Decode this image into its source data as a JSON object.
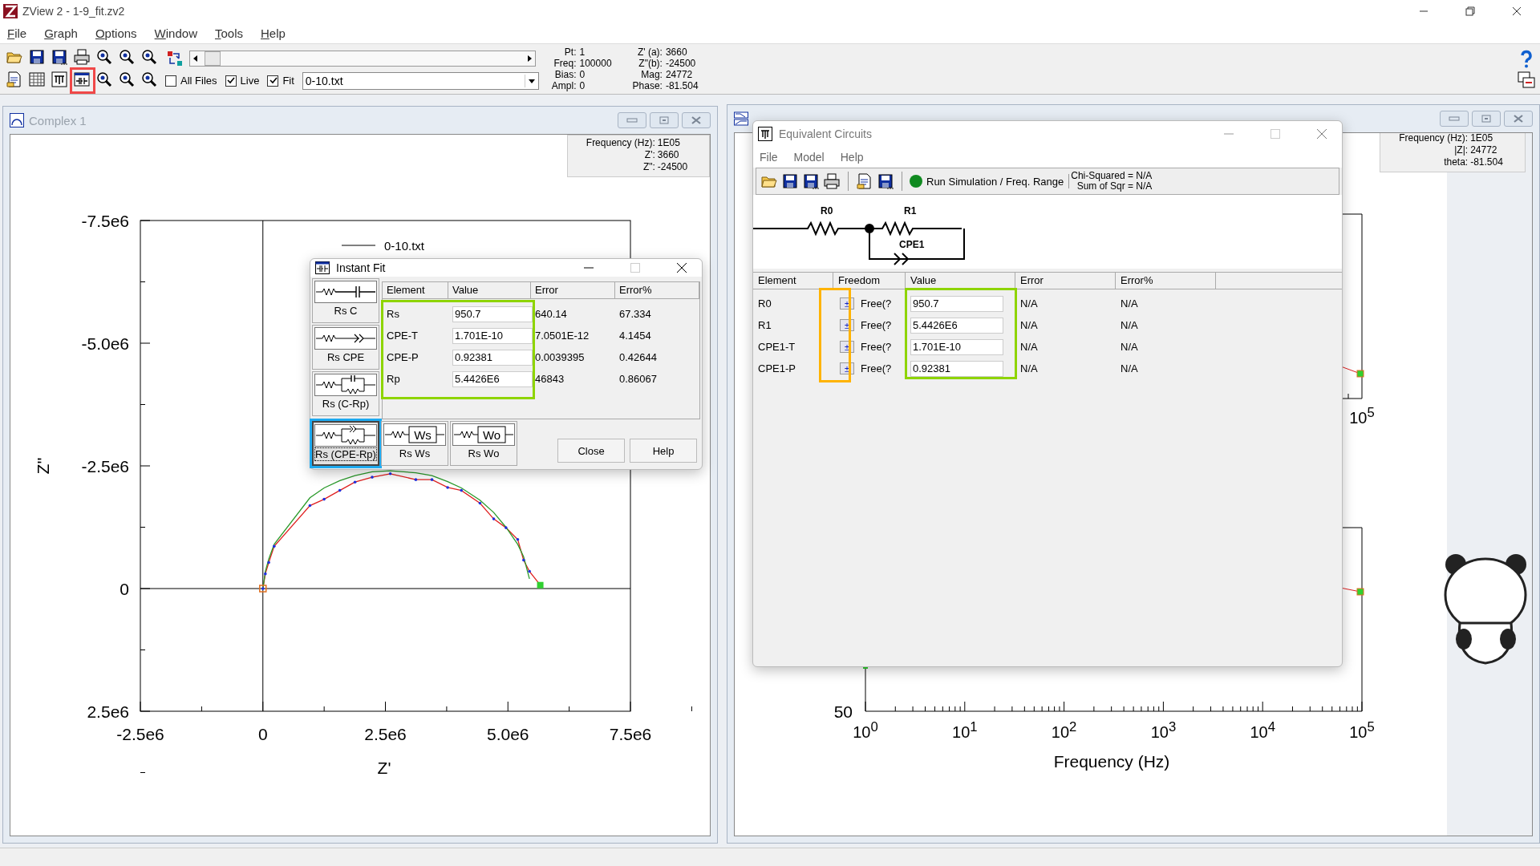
{
  "window": {
    "title": "ZView 2 - 1-9_fit.zv2"
  },
  "menu": [
    "File",
    "Graph",
    "Options",
    "Window",
    "Tools",
    "Help"
  ],
  "toolbar": {
    "checkboxes": [
      {
        "label": "All Files",
        "checked": false
      },
      {
        "label": "Live",
        "checked": true
      },
      {
        "label": "Fit",
        "checked": true
      }
    ],
    "file_combo": {
      "value": "0-10.txt"
    }
  },
  "readout": {
    "left": [
      {
        "label": "Pt:",
        "value": "1"
      },
      {
        "label": "Freq:",
        "value": "100000"
      },
      {
        "label": "Bias:",
        "value": "0"
      },
      {
        "label": "Ampl:",
        "value": "0"
      }
    ],
    "right": [
      {
        "label": "Z' (a):",
        "value": "3660"
      },
      {
        "label": "Z\"(b):",
        "value": "-24500"
      },
      {
        "label": "Mag:",
        "value": "24772"
      },
      {
        "label": "Phase:",
        "value": "-81.504"
      }
    ]
  },
  "complex_window": {
    "title": "Complex 1",
    "cursor_info": [
      {
        "label": "Frequency (Hz):",
        "value": "1E05"
      },
      {
        "label": "Z':",
        "value": "3660"
      },
      {
        "label": "Z\":",
        "value": "-24500"
      }
    ],
    "chart_data": {
      "type": "line",
      "xlabel": "Z'",
      "ylabel": "Z''",
      "x": [
        0,
        50000,
        120000,
        230000,
        960000,
        1250000,
        1570000,
        1880000,
        2230000,
        2600000,
        3120000,
        3450000,
        3770000,
        4050000,
        4430000,
        4710000,
        4960000,
        5200000,
        5320000,
        5440000,
        5660000
      ],
      "series": [
        {
          "name": "0-10.txt",
          "color": "#e02020",
          "values": [
            0,
            -300000,
            -530000,
            -860000,
            -1690000,
            -1820000,
            -2000000,
            -2170000,
            -2270000,
            -2340000,
            -2220000,
            -2220000,
            -2060000,
            -2000000,
            -1740000,
            -1420000,
            -1240000,
            -1000000,
            -580000,
            -350000,
            -70000
          ]
        },
        {
          "color": "#2a9a2a",
          "values": [
            0,
            -350000,
            -600000,
            -900000,
            -1850000,
            -2050000,
            -2200000,
            -2300000,
            -2380000,
            -2400000,
            -2360000,
            -2300000,
            -2180000,
            -2050000,
            -1800000,
            -1550000,
            -1250000,
            -900000,
            -650000,
            -200000,
            null
          ]
        }
      ],
      "xlim": [
        -2500000,
        7500000
      ],
      "ylim": [
        2500000,
        -7500000
      ],
      "xticks": [
        {
          "value": -2500000,
          "label": "-2.5e6"
        },
        {
          "value": 0,
          "label": "0"
        },
        {
          "value": 2500000,
          "label": "2.5e6"
        },
        {
          "value": 5000000,
          "label": "5.0e6"
        },
        {
          "value": 7500000,
          "label": "7.5e6"
        }
      ],
      "yticks": [
        {
          "value": -7500000,
          "label": "-7.5e6"
        },
        {
          "value": -5000000,
          "label": "-5.0e6"
        },
        {
          "value": -2500000,
          "label": "-2.5e6"
        },
        {
          "value": 0,
          "label": "0"
        },
        {
          "value": 2500000,
          "label": "2.5e6"
        }
      ]
    }
  },
  "instant_fit": {
    "title": "Instant Fit",
    "models": [
      {
        "kind": "r-c",
        "label": "Rs C",
        "selected": false
      },
      {
        "kind": "r-cpe",
        "label": "Rs CPE",
        "selected": false
      },
      {
        "kind": "r-c-rp",
        "label": "Rs (C-Rp)",
        "selected": false
      },
      {
        "kind": "r-cpe-rp",
        "label": "Rs (CPE-Rp)",
        "selected": true
      },
      {
        "kind": "r-ws",
        "label": "Rs Ws",
        "symbol": "Ws",
        "selected": false
      },
      {
        "kind": "r-wo",
        "label": "Rs Wo",
        "symbol": "Wo",
        "selected": false
      }
    ],
    "columns": [
      "Element",
      "Value",
      "Error",
      "Error%"
    ],
    "rows": [
      {
        "element": "Rs",
        "value": "950.7",
        "error": "640.14",
        "error_pct": "67.334"
      },
      {
        "element": "CPE-T",
        "value": "1.701E-10",
        "error": "7.0501E-12",
        "error_pct": "4.1454"
      },
      {
        "element": "CPE-P",
        "value": "0.92381",
        "error": "0.0039395",
        "error_pct": "0.42644"
      },
      {
        "element": "Rp",
        "value": "5.4426E6",
        "error": "46843",
        "error_pct": "0.86067"
      }
    ],
    "buttons": [
      "Close",
      "Help"
    ]
  },
  "bode_window": {
    "cursor_info": [
      {
        "label": "Frequency (Hz):",
        "value": "1E05"
      },
      {
        "label": "|Z|:",
        "value": "24772"
      },
      {
        "label": "theta:",
        "value": "-81.504"
      }
    ],
    "upper_tick_label": "10$^{5}$",
    "x_tick_labels": [
      "10$^{0}$",
      "10$^{1}$",
      "10$^{2}$",
      "10$^{3}$",
      "10$^{4}$",
      "10$^{5}$"
    ],
    "xlabel": "Frequency (Hz)",
    "y_tick_label": "50"
  },
  "equivalent_circuits": {
    "title": "Equivalent Circuits",
    "menu": [
      "File",
      "Model",
      "Help"
    ],
    "run_label": "Run Simulation / Freq. Range",
    "chi_squared": "Chi-Squared = N/A",
    "sum_of_sqr": "Sum of Sqr = N/A",
    "diagram_labels": [
      "R0",
      "R1",
      "CPE1"
    ],
    "columns": [
      "Element",
      "Freedom",
      "Value",
      "Error",
      "Error%"
    ],
    "rows": [
      {
        "element": "R0",
        "freedom_button": "±",
        "freedom": "Free(?",
        "value": "950.7",
        "error": "N/A",
        "error_pct": "N/A"
      },
      {
        "element": "R1",
        "freedom_button": "±",
        "freedom": "Free(?",
        "value": "5.4426E6",
        "error": "N/A",
        "error_pct": "N/A"
      },
      {
        "element": "CPE1-T",
        "freedom_button": "±",
        "freedom": "Free(?",
        "value": "1.701E-10",
        "error": "N/A",
        "error_pct": "N/A"
      },
      {
        "element": "CPE1-P",
        "freedom_button": "±",
        "freedom": "Free(?",
        "value": "0.92381",
        "error": "N/A",
        "error_pct": "N/A"
      }
    ]
  },
  "annotations": [
    {
      "kind": "toolbar-button",
      "color": "#f04848"
    },
    {
      "kind": "fit-values",
      "color": "#8ed400"
    },
    {
      "kind": "fit-model",
      "color": "#1eaaf0"
    },
    {
      "kind": "circuit-freedom",
      "color": "#ffb300"
    },
    {
      "kind": "circuit-values",
      "color": "#8ed400"
    }
  ]
}
